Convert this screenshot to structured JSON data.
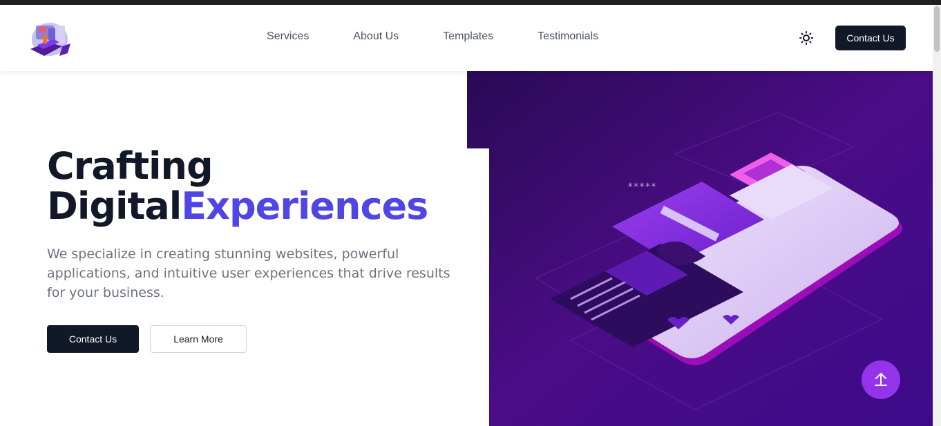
{
  "nav": {
    "items": [
      "Services",
      "About Us",
      "Templates",
      "Testimonials"
    ],
    "contact_label": "Contact Us"
  },
  "hero": {
    "title_line1": "Crafting",
    "title_line2_a": "Digital",
    "title_line2_b": "Experiences",
    "subtitle": "We specialize in creating stunning websites, powerful applications, and intuitive user experiences that drive results for your business.",
    "primary_label": "Contact Us",
    "secondary_label": "Learn More"
  },
  "icons": {
    "theme": "sun-icon",
    "scroll_top": "arrow-up-icon",
    "logo": "logo-illustration"
  },
  "colors": {
    "dark": "#111827",
    "accent": "#4f46e5",
    "purple": "#9333ea",
    "hero_bg": "#3b0a6b"
  }
}
